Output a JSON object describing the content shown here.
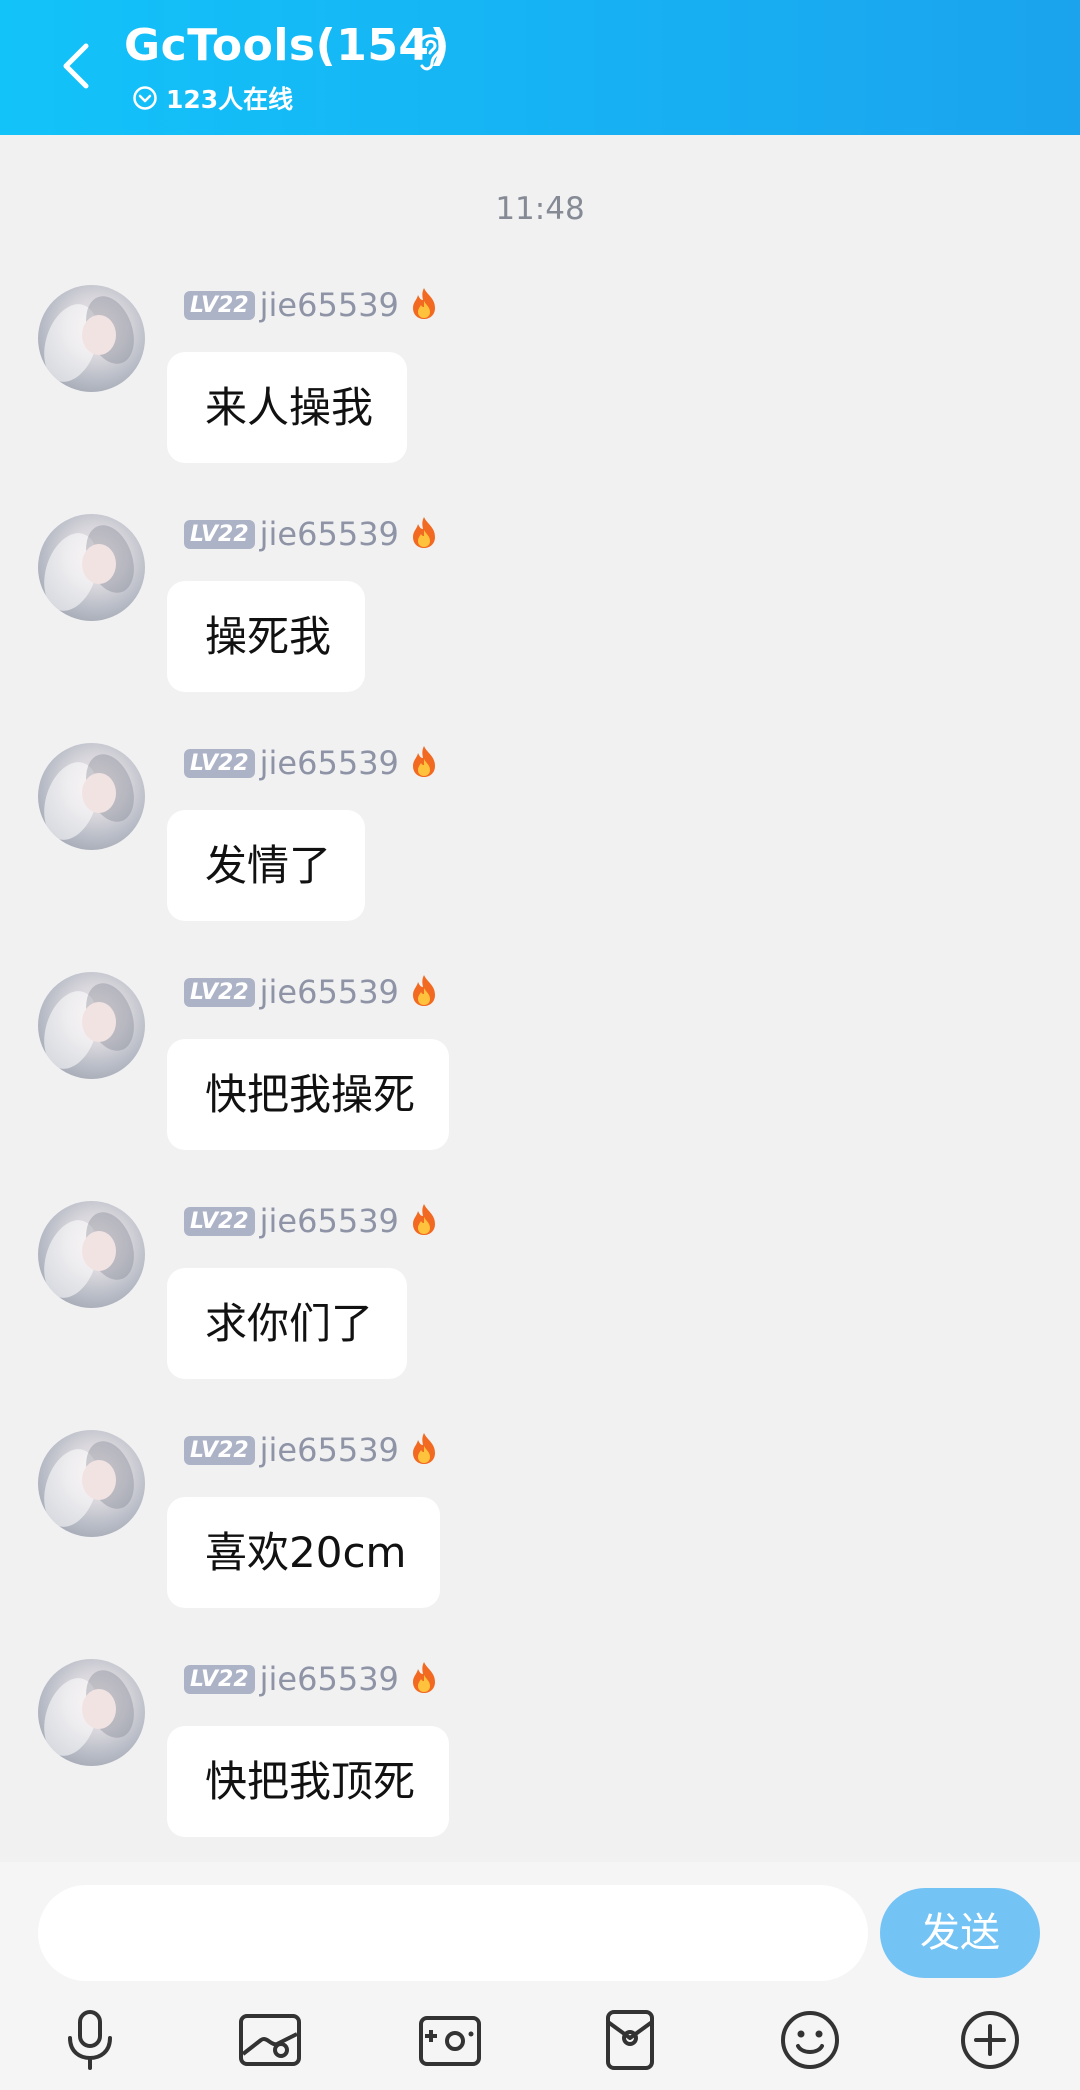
{
  "header": {
    "title": "GcTools(154)",
    "online": "123人在线"
  },
  "chat": {
    "time": "11:48",
    "messages": [
      {
        "level": "LV22",
        "username": "jie65539",
        "text": "来人操我"
      },
      {
        "level": "LV22",
        "username": "jie65539",
        "text": "操死我"
      },
      {
        "level": "LV22",
        "username": "jie65539",
        "text": "发情了"
      },
      {
        "level": "LV22",
        "username": "jie65539",
        "text": "快把我操死"
      },
      {
        "level": "LV22",
        "username": "jie65539",
        "text": "求你们了"
      },
      {
        "level": "LV22",
        "username": "jie65539",
        "text": "喜欢20cm"
      },
      {
        "level": "LV22",
        "username": "jie65539",
        "text": "快把我顶死"
      }
    ]
  },
  "composer": {
    "placeholder": "",
    "send_label": "发送"
  },
  "toolbar": {
    "icons": [
      "microphone-icon",
      "image-icon",
      "camera-icon",
      "red-packet-icon",
      "emoji-icon",
      "plus-icon"
    ]
  },
  "colors": {
    "header_gradient_start": "#12c3f9",
    "header_gradient_end": "#1ba3ee",
    "send_button": "#74c3f5",
    "level_badge": "#adb3c7"
  }
}
